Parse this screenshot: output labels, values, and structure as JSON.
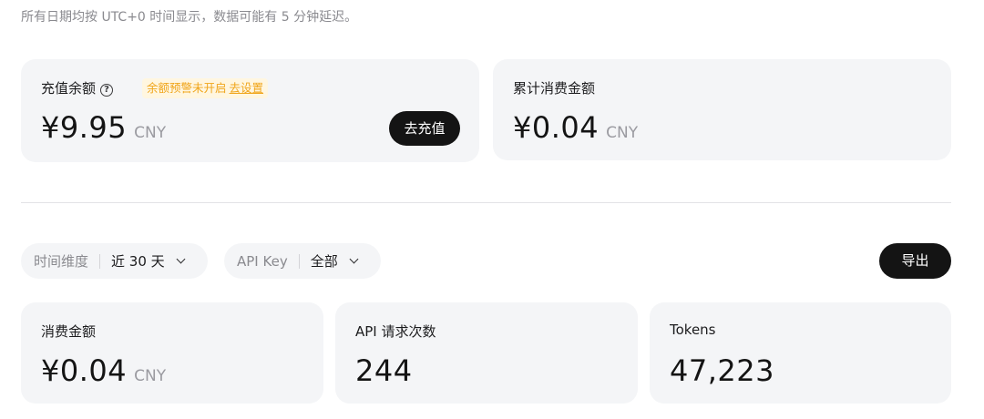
{
  "notice": "所有日期均按 UTC+0 时间显示，数据可能有 5 分钟延迟。",
  "balance_card": {
    "label": "充值余额",
    "help_icon": "?",
    "alert_text": "余额预警未开启",
    "alert_link": "去设置",
    "amount": "¥9.95",
    "currency": "CNY",
    "topup_label": "去充值"
  },
  "spent_card": {
    "label": "累计消费金额",
    "amount": "¥0.04",
    "currency": "CNY"
  },
  "filters": {
    "time_label": "时间维度",
    "time_value": "近 30 天",
    "key_label": "API Key",
    "key_value": "全部"
  },
  "export_label": "导出",
  "stats": {
    "spent": {
      "label": "消费金额",
      "value": "¥0.04",
      "currency": "CNY"
    },
    "requests": {
      "label": "API 请求次数",
      "value": "244"
    },
    "tokens": {
      "label": "Tokens",
      "value": "47,223"
    }
  },
  "colors": {
    "card_bg": "#f4f5f7",
    "button_dark": "#141414",
    "alert_text": "#f0a51a",
    "alert_bg": "#fff6e0"
  }
}
